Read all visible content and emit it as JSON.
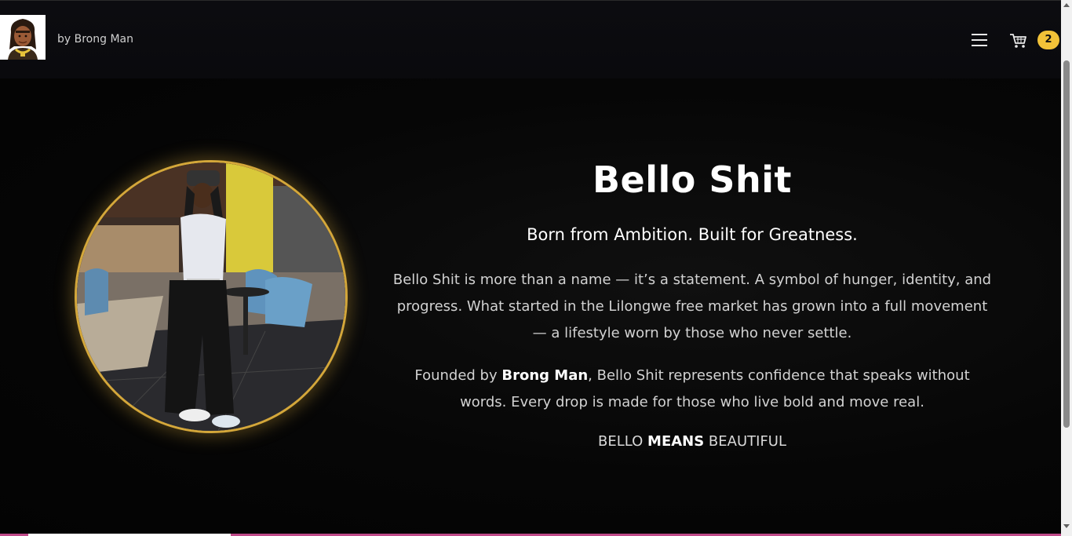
{
  "header": {
    "brand_text": "by Brong Man",
    "menu_icon": "hamburger-menu-icon",
    "cart_icon": "shopping-cart-icon",
    "cart_count": "2",
    "badge_color": "#f2c238"
  },
  "hero": {
    "title": "Bello Shit",
    "subtitle": "Born from Ambition. Built for Greatness.",
    "paragraph1": "Bello Shit is more than a name — it’s a statement. A symbol of hunger, identity, and progress. What started in the Lilongwe free market has grown into a full movement — a lifestyle worn by those who never settle.",
    "paragraph2_prefix": "Founded by ",
    "paragraph2_bold": "Brong Man",
    "paragraph2_suffix": ", Bello Shit represents confidence that speaks without words. Every drop is made for those who live bold and move real.",
    "motto_part1": "BELLO ",
    "motto_bold": "MEANS",
    "motto_part2": " BEAUTIFUL",
    "accent_color": "#d4a73a"
  }
}
